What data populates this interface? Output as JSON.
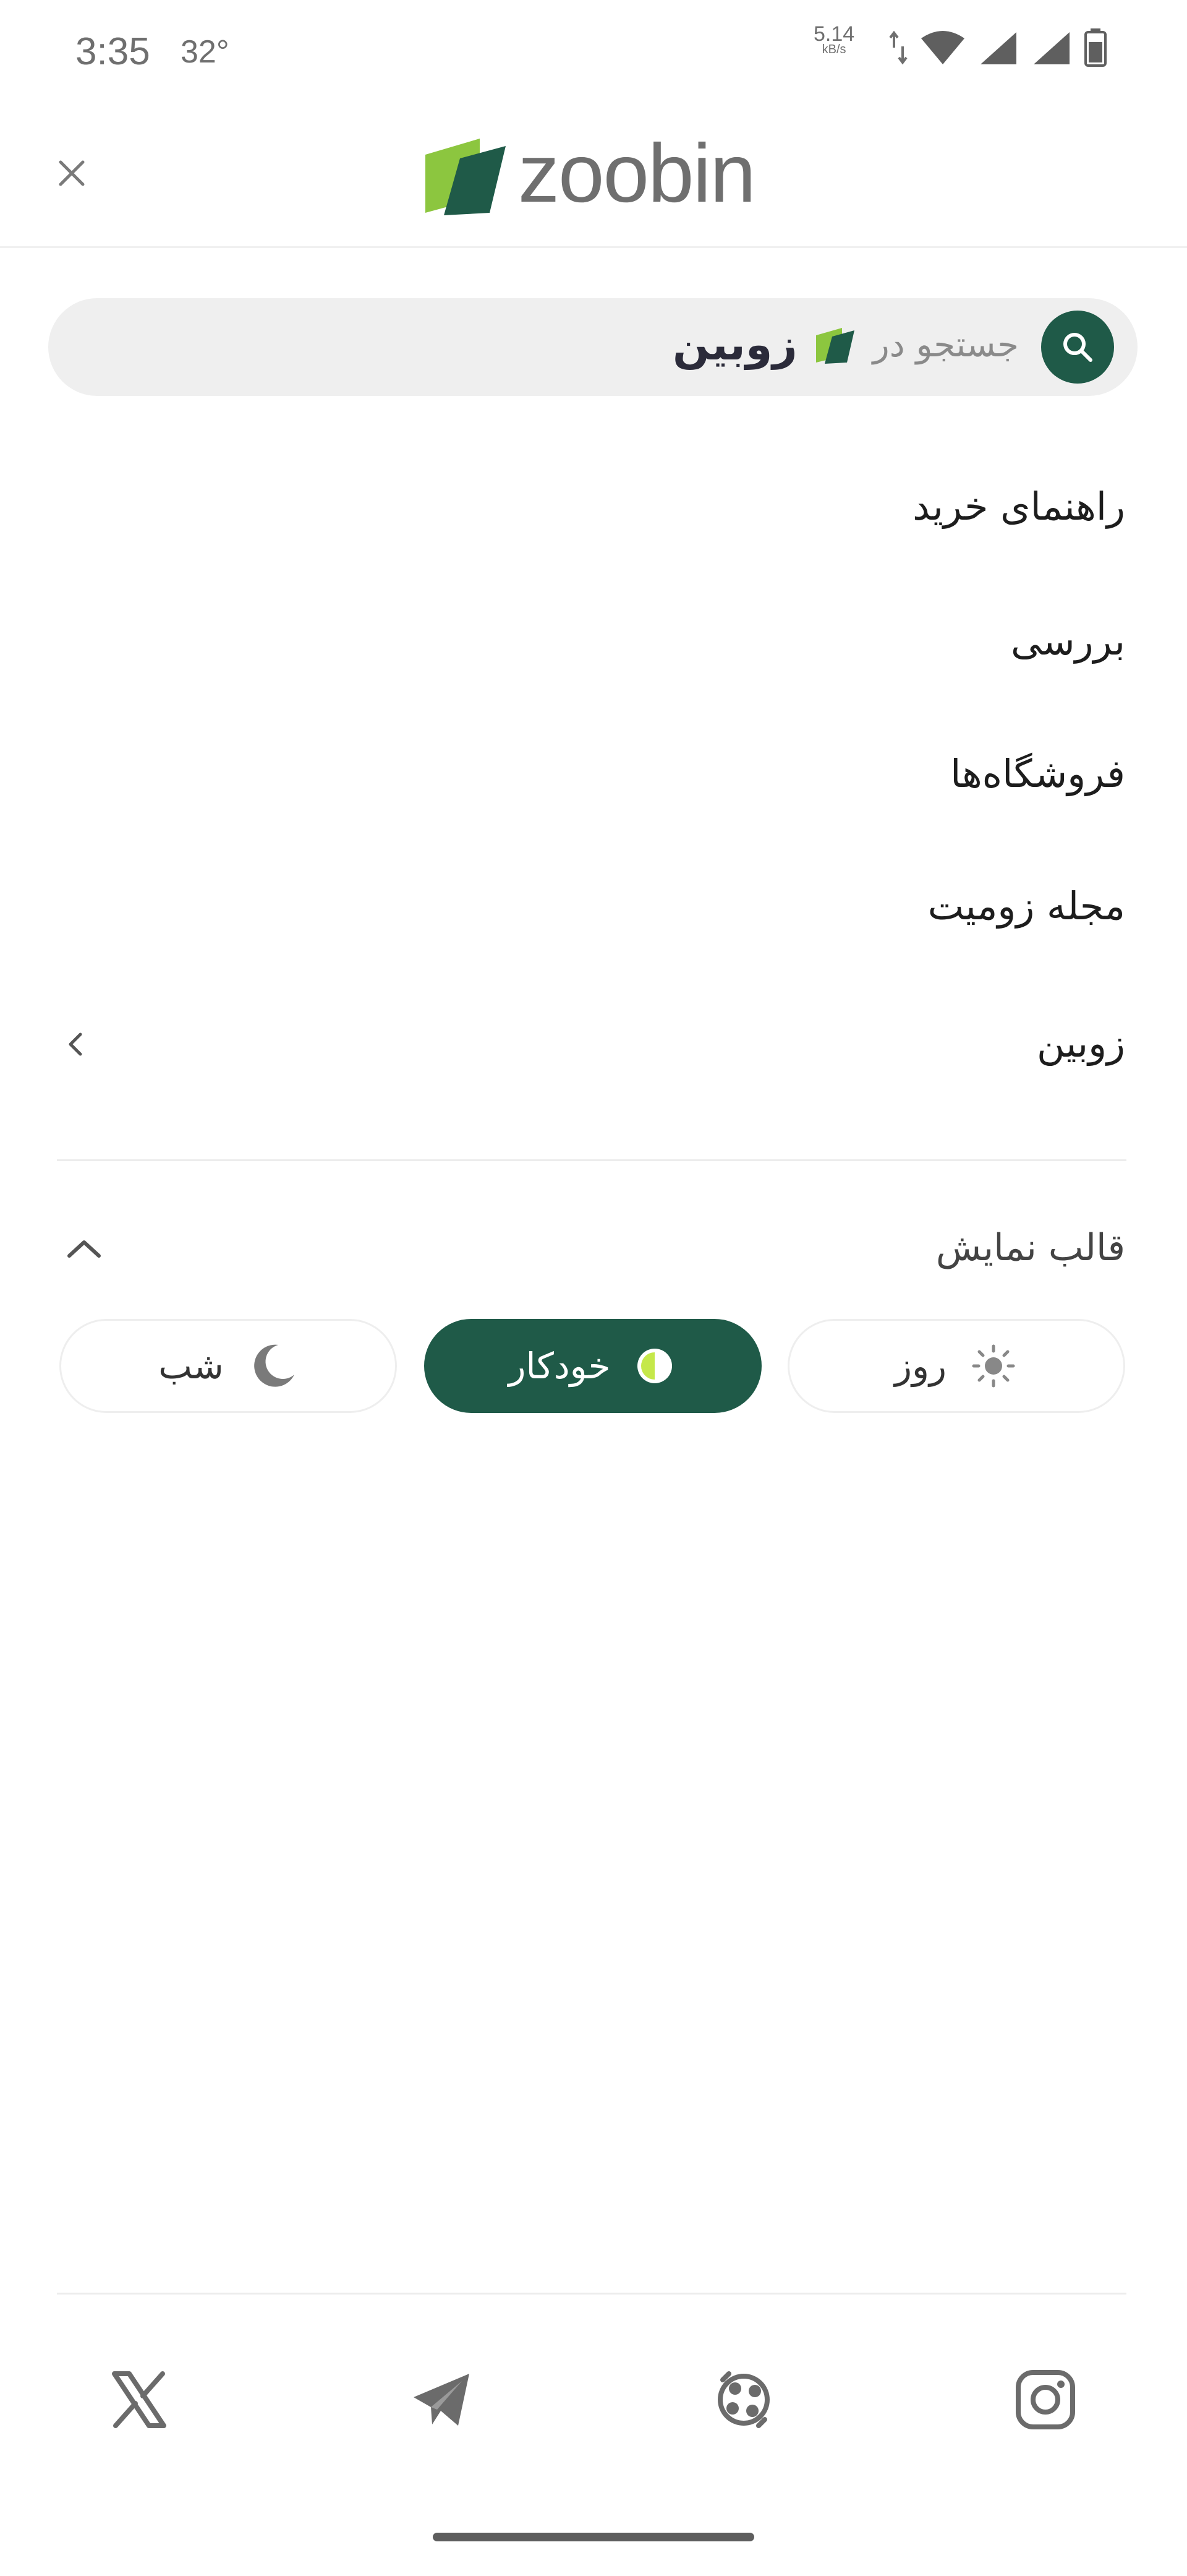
{
  "status_bar": {
    "time": "3:35",
    "temperature": "32°",
    "net_speed": "5.14",
    "net_unit": "kB/s"
  },
  "header": {
    "brand": "zoobin",
    "close_icon": "close-icon"
  },
  "search": {
    "prefix": "جستجو در",
    "brand": "زوبین"
  },
  "menu": {
    "items": [
      {
        "label": "راهنمای خرید"
      },
      {
        "label": "بررسی"
      },
      {
        "label": "فروشگاه‌ها"
      },
      {
        "label": "مجله زومیت"
      },
      {
        "label": "زوبین",
        "has_submenu": true
      }
    ]
  },
  "theme": {
    "title": "قالب نمایش",
    "options": [
      {
        "label": "روز",
        "icon": "sun-icon",
        "active": false
      },
      {
        "label": "خودکار",
        "icon": "half-circle-icon",
        "active": true
      },
      {
        "label": "شب",
        "icon": "moon-icon",
        "active": false
      }
    ]
  },
  "footer": {
    "social": [
      "instagram-icon",
      "aparat-icon",
      "telegram-icon",
      "x-icon"
    ]
  },
  "colors": {
    "brand_green": "#1f5a48",
    "logo_light_green": "#8cc63f",
    "logo_dark_green": "#1f5a48"
  }
}
